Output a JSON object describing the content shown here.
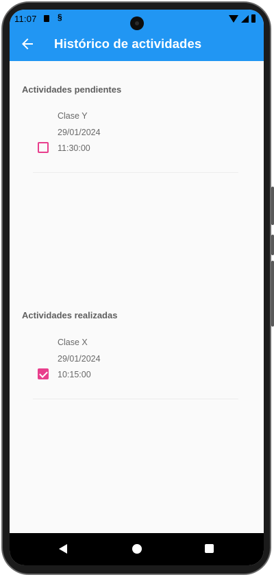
{
  "status_bar": {
    "time": "11:07",
    "icons": [
      "sd-card-icon",
      "s-app-icon",
      "wifi-icon",
      "cell-signal-icon",
      "battery-icon"
    ]
  },
  "app_bar": {
    "title": "Histórico de actividades",
    "back_icon": "arrow-back-icon",
    "background_color": "#2196f3"
  },
  "sections": {
    "pending": {
      "title": "Actividades pendientes",
      "items": [
        {
          "name": "Clase Y",
          "date": "29/01/2024",
          "time": "11:30:00",
          "checked": false
        }
      ]
    },
    "done": {
      "title": "Actividades realizadas",
      "items": [
        {
          "name": "Clase X",
          "date": "29/01/2024",
          "time": "10:15:00",
          "checked": true
        }
      ]
    }
  },
  "checkbox_color": "#e83e8c",
  "nav_bar": {
    "buttons": [
      "nav-back-icon",
      "nav-home-icon",
      "nav-recents-icon"
    ]
  }
}
